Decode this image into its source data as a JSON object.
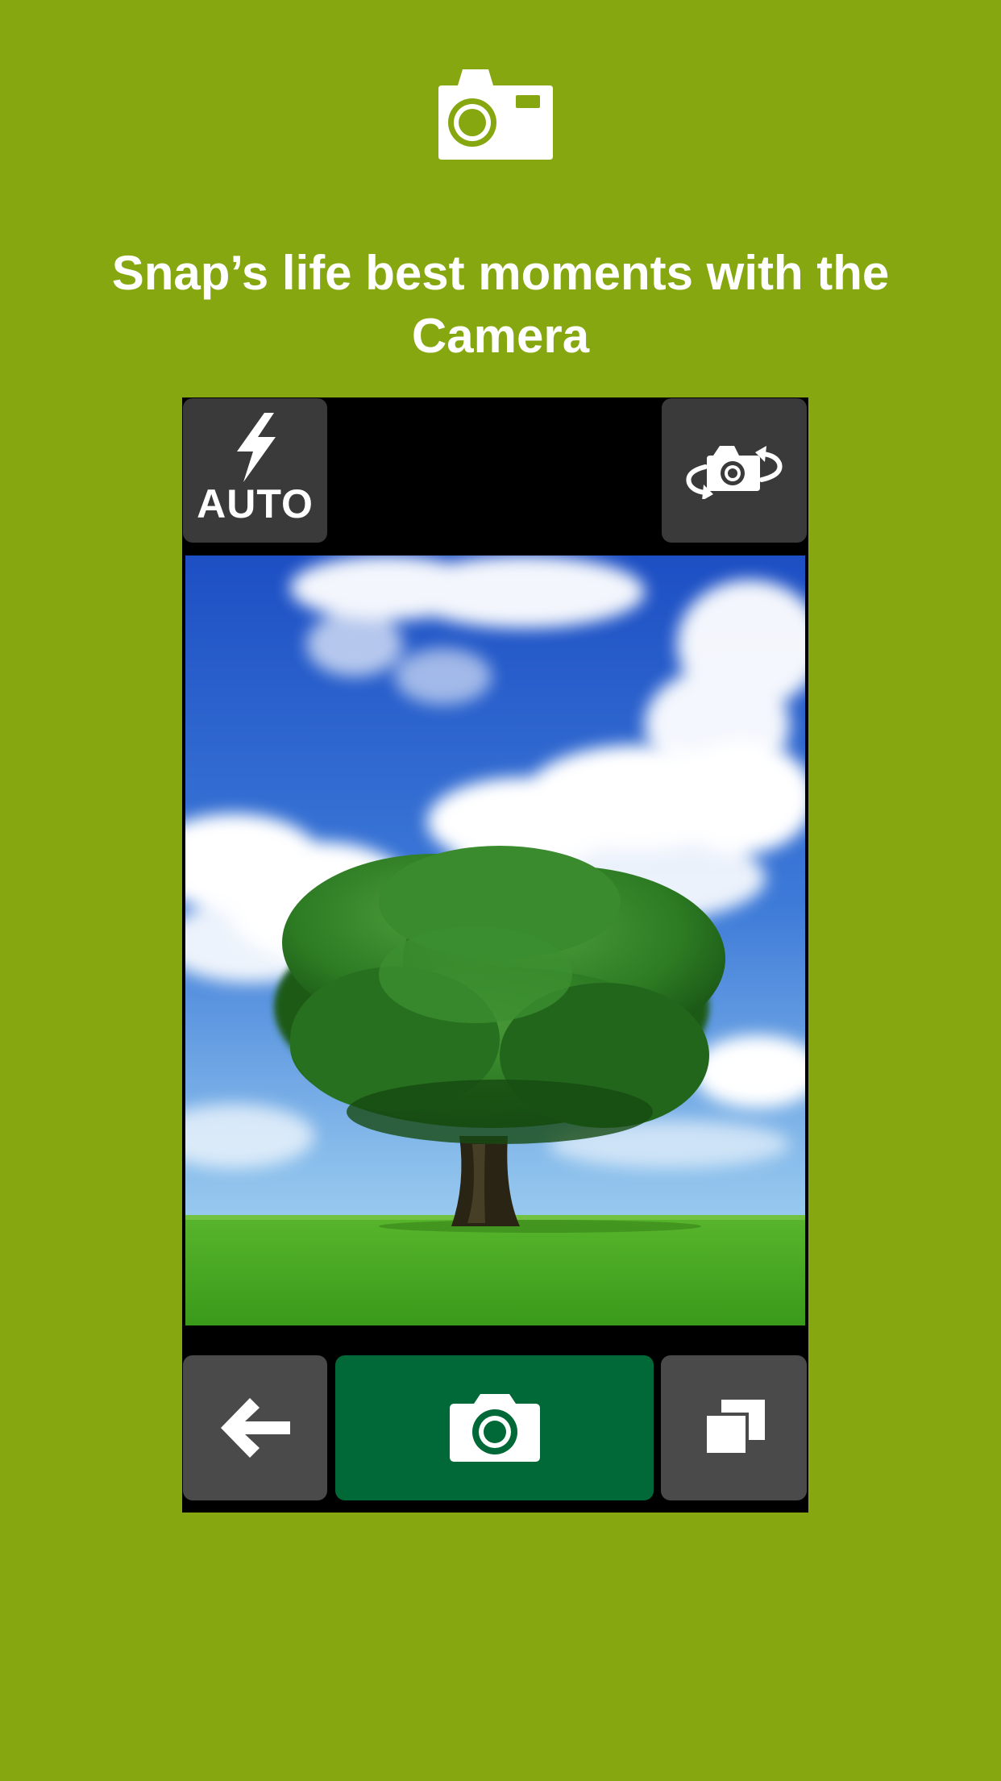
{
  "header": {
    "icon": "camera-icon",
    "headline": "Snap’s life best moments with the Camera"
  },
  "camera_ui": {
    "top_bar": {
      "flash_icon": "lightning-bolt-icon",
      "flash_mode_label": "AUTO",
      "switch_camera_icon": "camera-switch-icon"
    },
    "viewfinder": {
      "scene": "tree-on-grassy-field-under-blue-sky"
    },
    "bottom_bar": {
      "back_icon": "arrow-left-icon",
      "shutter_icon": "camera-icon",
      "gallery_icon": "stacked-squares-icon"
    }
  },
  "colors": {
    "background": "#86a710",
    "phone_frame": "#000000",
    "button_dark": "#3a3a3a",
    "button_gray": "#4a4a4a",
    "shutter": "#006937",
    "text": "#ffffff"
  }
}
